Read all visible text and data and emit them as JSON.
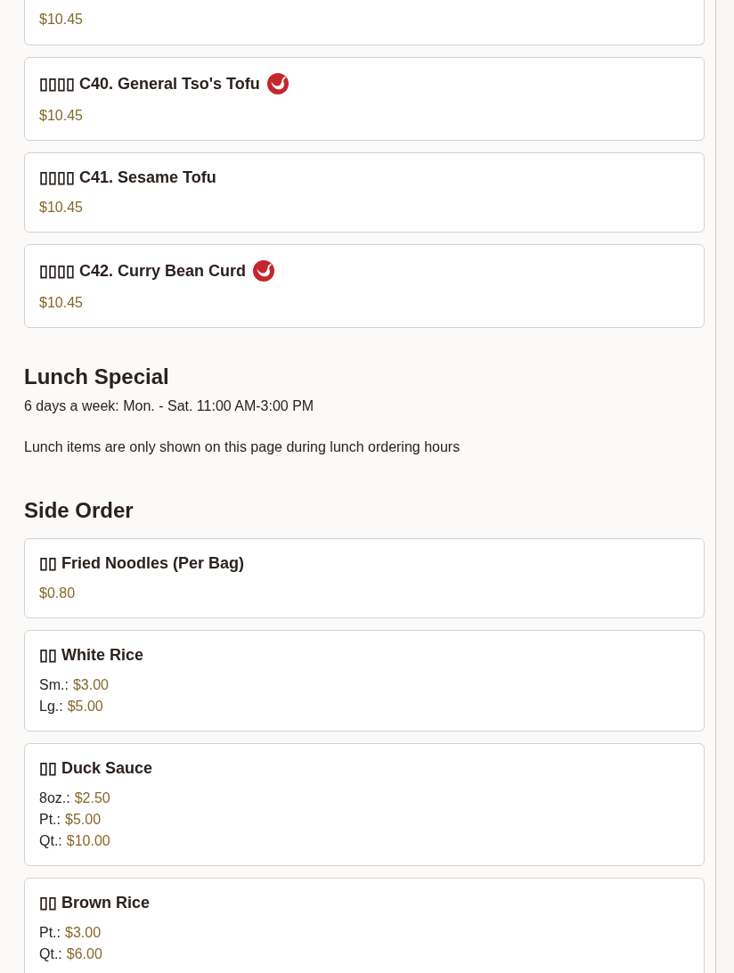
{
  "partial_item": {
    "prices": [
      {
        "price": "$10.45"
      }
    ]
  },
  "items": [
    {
      "name": "▯▯▯▯ C40. General Tso's Tofu",
      "spicy": true,
      "prices": [
        {
          "price": "$10.45"
        }
      ]
    },
    {
      "name": "▯▯▯▯ C41. Sesame Tofu",
      "spicy": false,
      "prices": [
        {
          "price": "$10.45"
        }
      ]
    },
    {
      "name": "▯▯▯▯ C42. Curry Bean Curd",
      "spicy": true,
      "prices": [
        {
          "price": "$10.45"
        }
      ]
    }
  ],
  "lunch_special": {
    "title": "Lunch Special",
    "hours": "6 days a week: Mon. - Sat. 11:00 AM-3:00 PM",
    "note": "Lunch items are only shown on this page during lunch ordering hours"
  },
  "side_order": {
    "title": "Side Order",
    "items": [
      {
        "name": "▯▯ Fried Noodles (Per Bag)",
        "spicy": false,
        "prices": [
          {
            "price": "$0.80"
          }
        ]
      },
      {
        "name": "▯▯ White Rice",
        "spicy": false,
        "prices": [
          {
            "size": "Sm.:",
            "price": "$3.00"
          },
          {
            "size": "Lg.:",
            "price": "$5.00"
          }
        ]
      },
      {
        "name": "▯▯ Duck Sauce",
        "spicy": false,
        "prices": [
          {
            "size": "8oz.:",
            "price": "$2.50"
          },
          {
            "size": "Pt.:",
            "price": "$5.00"
          },
          {
            "size": "Qt.:",
            "price": "$10.00"
          }
        ]
      },
      {
        "name": "▯▯ Brown Rice",
        "spicy": false,
        "prices": [
          {
            "size": "Pt.:",
            "price": "$3.00"
          },
          {
            "size": "Qt.:",
            "price": "$6.00"
          }
        ]
      }
    ]
  }
}
